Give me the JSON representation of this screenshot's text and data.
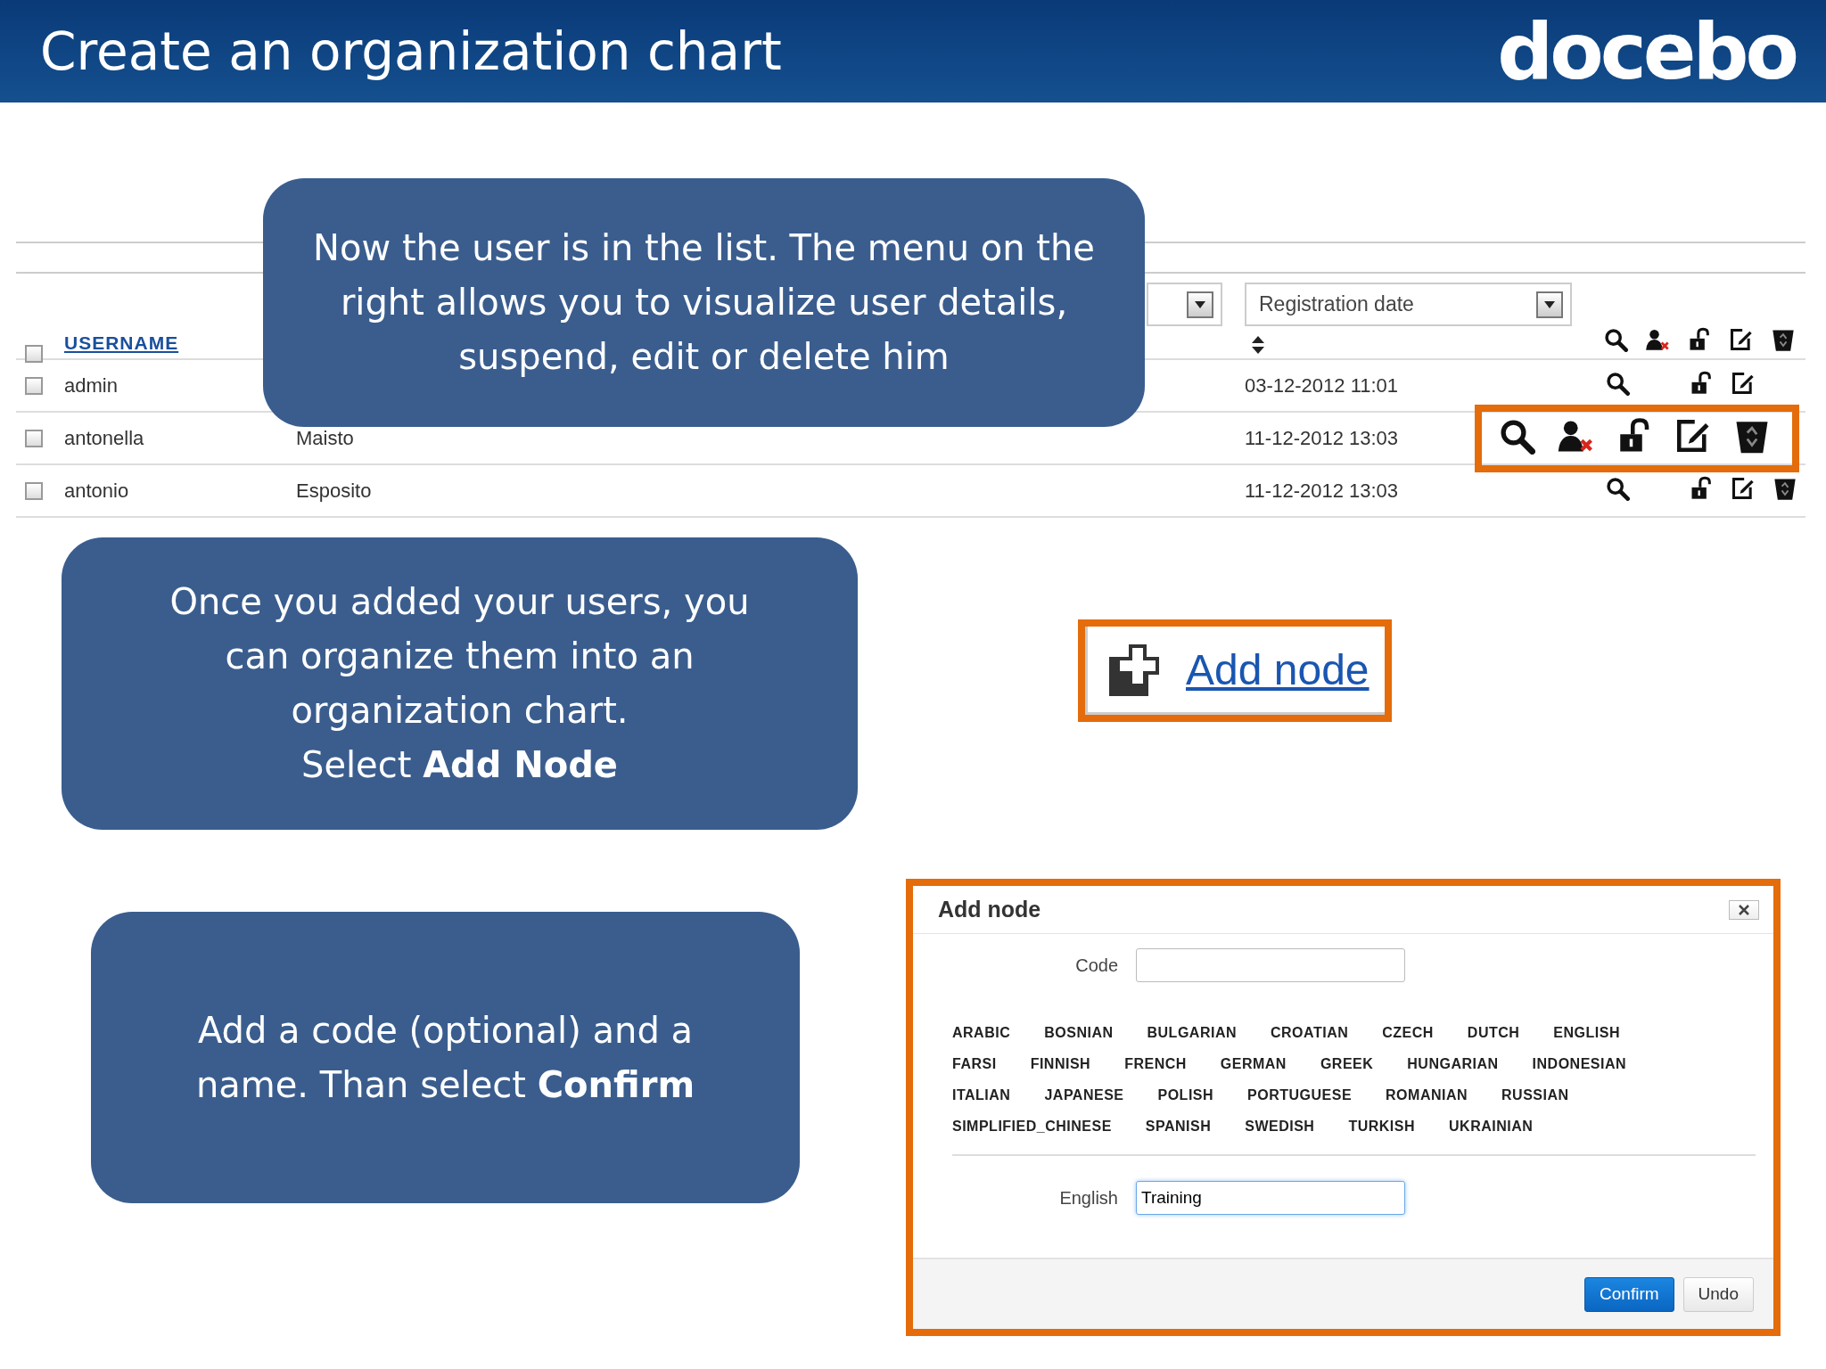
{
  "header": {
    "title": "Create an organization chart",
    "logo": "docebo"
  },
  "user_table": {
    "select_all": {
      "checked": false
    },
    "columns": [
      {
        "label": "USERNAME"
      }
    ],
    "filter_select": {
      "value": "Registration date"
    },
    "rows": [
      {
        "checked": false,
        "highlighted": false,
        "username": "admin",
        "last_name": "",
        "registered": "03-12-2012 11:01",
        "actions": [
          {
            "kind": "view"
          },
          {
            "kind": "unlock"
          },
          {
            "kind": "edit"
          }
        ]
      },
      {
        "checked": false,
        "highlighted": true,
        "username": "antonella",
        "last_name": "Maisto",
        "registered": "11-12-2012 13:03",
        "actions": [
          {
            "kind": "view"
          },
          {
            "kind": "suspend"
          },
          {
            "kind": "unlock"
          },
          {
            "kind": "edit"
          },
          {
            "kind": "delete"
          }
        ]
      },
      {
        "checked": false,
        "highlighted": false,
        "username": "antonio",
        "last_name": "Esposito",
        "registered": "11-12-2012 13:03",
        "actions": [
          {
            "kind": "view"
          },
          {
            "kind": "unlock"
          },
          {
            "kind": "edit"
          },
          {
            "kind": "delete"
          }
        ]
      }
    ],
    "header_actions": [
      {
        "kind": "view"
      },
      {
        "kind": "suspend"
      },
      {
        "kind": "unlock"
      },
      {
        "kind": "edit"
      },
      {
        "kind": "delete"
      }
    ]
  },
  "callouts": [
    {
      "paragraphs": [
        "Now the user is in the list. The menu on the right allows you to visualize user details, suspend, edit or delete him"
      ]
    },
    {
      "paragraphs": [
        "Once you added your users, you can organize them into an organization chart.",
        "Select **Add Node**"
      ]
    },
    {
      "paragraphs": [
        "Add a code (optional) and a name. Than select **Confirm**"
      ]
    }
  ],
  "add_node_link": {
    "label": "Add node"
  },
  "dialog": {
    "title": "Add node",
    "code_label": "Code",
    "language_rows": [
      [
        "ARABIC",
        "BOSNIAN",
        "BULGARIAN",
        "CROATIAN",
        "CZECH",
        "DUTCH",
        "ENGLISH"
      ],
      [
        "FARSI",
        "FINNISH",
        "FRENCH",
        "GERMAN",
        "GREEK",
        "HUNGARIAN",
        "INDONESIAN"
      ],
      [
        "ITALIAN",
        "JAPANESE",
        "POLISH",
        "PORTUGUESE",
        "ROMANIAN",
        "RUSSIAN"
      ],
      [
        "SIMPLIFIED_CHINESE",
        "SPANISH",
        "SWEDISH",
        "TURKISH",
        "UKRAINIAN"
      ]
    ],
    "name_label": "English",
    "name_value": "Training",
    "buttons": [
      {
        "kind": "primary",
        "label": "Confirm"
      },
      {
        "kind": "secondary",
        "label": "Undo"
      }
    ]
  }
}
